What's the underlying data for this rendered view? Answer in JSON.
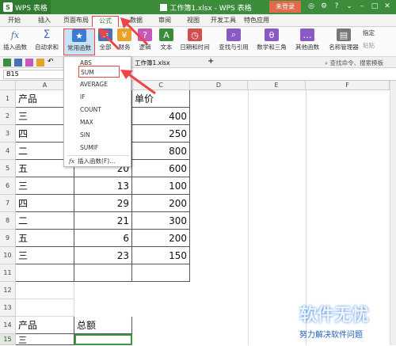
{
  "titlebar": {
    "app_name": "WPS 表格",
    "doc_title": "工作簿1.xlsx - WPS 表格",
    "login_label": "未登录"
  },
  "tabs": [
    "开始",
    "插入",
    "页面布局",
    "公式",
    "数据",
    "审阅",
    "视图",
    "开发工具",
    "特色应用"
  ],
  "active_tab": "公式",
  "ribbon": {
    "buttons": [
      {
        "label": "插入函数",
        "icon": "fx-icon",
        "color": "#4a6fb5"
      },
      {
        "label": "自动求和",
        "icon": "sigma-icon",
        "color": "#4a6fb5"
      },
      {
        "label": "常用函数",
        "icon": "star-icon",
        "color": "#3a7bd5"
      },
      {
        "label": "全部",
        "icon": "list-icon",
        "color": "#4a6fb5"
      },
      {
        "label": "财务",
        "icon": "money-icon",
        "color": "#e8a12b"
      },
      {
        "label": "逻辑",
        "icon": "question-icon",
        "color": "#c45ab5"
      },
      {
        "label": "文本",
        "icon": "text-icon",
        "color": "#3c8c3c"
      },
      {
        "label": "日期和时间",
        "icon": "clock-icon",
        "color": "#d24e4e"
      },
      {
        "label": "查找与引用",
        "icon": "search-icon",
        "color": "#8a5ac4"
      },
      {
        "label": "数学和三角",
        "icon": "math-icon",
        "color": "#8a5ac4"
      },
      {
        "label": "其他函数",
        "icon": "more-icon",
        "color": "#8a5ac4"
      },
      {
        "label": "名称管理器",
        "icon": "name-manager-icon",
        "color": "#555555"
      }
    ],
    "right_labels": [
      "指定",
      "粘贴"
    ]
  },
  "file_tab": "工作簿1.xlsx",
  "search_placeholder": "查找命令、搜索模板",
  "namebox_value": "B15",
  "dropdown": {
    "items": [
      "ABS",
      "SUM",
      "AVERAGE",
      "IF",
      "COUNT",
      "MAX",
      "SIN",
      "SUMIF"
    ],
    "insert_label": "插入函数(F)...",
    "insert_icon": "fx",
    "highlighted": "SUM"
  },
  "columns": [
    "A",
    "B",
    "C",
    "D",
    "E",
    "F"
  ],
  "rows": [
    "1",
    "2",
    "3",
    "4",
    "5",
    "6",
    "7",
    "8",
    "9",
    "10",
    "11",
    "12",
    "13",
    "14",
    "15"
  ],
  "table": {
    "header": [
      "产品",
      "",
      "单价"
    ],
    "rows": [
      [
        "三",
        "",
        "400"
      ],
      [
        "四",
        "",
        "250"
      ],
      [
        "二",
        "",
        "800"
      ],
      [
        "五",
        "20",
        "600"
      ],
      [
        "三",
        "13",
        "100"
      ],
      [
        "四",
        "29",
        "200"
      ],
      [
        "二",
        "21",
        "300"
      ],
      [
        "五",
        "6",
        "200"
      ],
      [
        "三",
        "23",
        "150"
      ]
    ]
  },
  "summary": {
    "label_product": "产品",
    "label_total": "总额",
    "row15_value": "三"
  },
  "watermark": {
    "title": "软件无忧",
    "subtitle": "努力解决软件问题"
  },
  "colors": {
    "titlebar": "#3c8c3c",
    "highlight_red": "#e44444",
    "selection_green": "#3c9a3c"
  }
}
